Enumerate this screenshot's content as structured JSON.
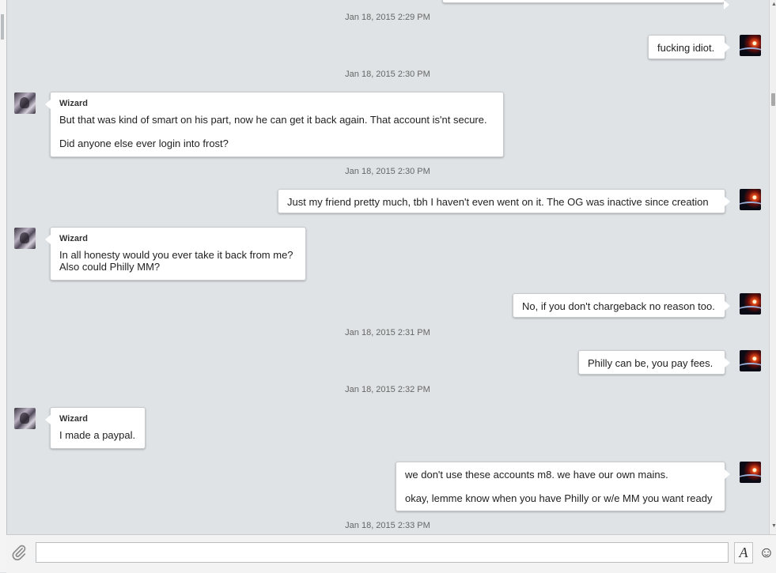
{
  "messages": [
    {
      "timestamp": "Jan 18, 2015 2:29 PM"
    },
    {
      "from": "me",
      "lines": [
        "fucking idiot."
      ]
    },
    {
      "timestamp": "Jan 18, 2015 2:30 PM"
    },
    {
      "from": "Wizard",
      "lines": [
        "But that was kind of smart on his part, now he can get it back again. That account is'nt secure.",
        "Did anyone else ever login into frost?"
      ]
    },
    {
      "timestamp": "Jan 18, 2015 2:30 PM"
    },
    {
      "from": "me",
      "lines": [
        "Just my friend pretty much, tbh I haven't even went on it. The OG was inactive since creation"
      ]
    },
    {
      "from": "Wizard",
      "lines": [
        "In all honesty would you ever take it back from me?\nAlso could Philly MM?"
      ]
    },
    {
      "from": "me",
      "lines": [
        "No, if you don't chargeback no reason too."
      ]
    },
    {
      "timestamp": "Jan 18, 2015 2:31 PM"
    },
    {
      "from": "me",
      "lines": [
        "Philly can be, you pay fees."
      ]
    },
    {
      "timestamp": "Jan 18, 2015 2:32 PM"
    },
    {
      "from": "Wizard",
      "lines": [
        "I made a paypal."
      ]
    },
    {
      "from": "me",
      "lines": [
        "we don't use these accounts m8. we have our own mains.",
        "okay, lemme know when you have Philly or w/e MM you want ready"
      ]
    },
    {
      "timestamp": "Jan 18, 2015 2:33 PM"
    }
  ],
  "composer": {
    "placeholder": "",
    "attach_icon": "paperclip-icon",
    "format_label": "A",
    "emoji_icon": "smiley-icon"
  },
  "colors": {
    "background": "#dfe3e6",
    "bubble": "#ffffff",
    "timestamp": "#666666"
  }
}
